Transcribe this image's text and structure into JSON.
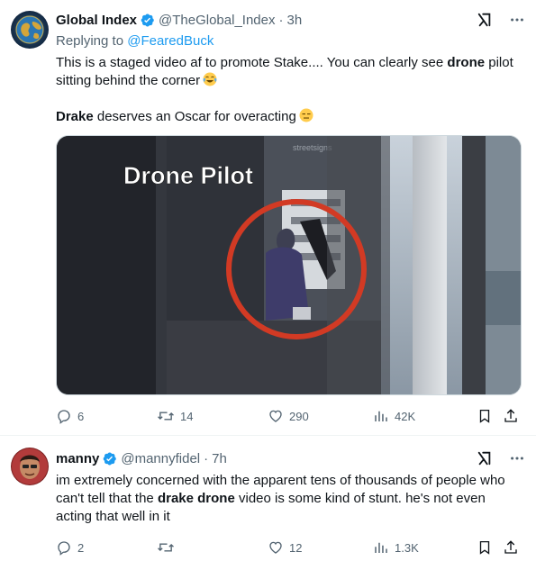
{
  "tweets": [
    {
      "author": "Global Index",
      "handle": "@TheGlobal_Index",
      "separator": "·",
      "time": "3h",
      "reply_prefix": "Replying to",
      "reply_handle": "@FearedBuck",
      "text": {
        "p1_a": "This is a staged video af to promote Stake.... You can clearly see ",
        "p1_bold": "drone",
        "p1_b": " pilot sitting behind the corner",
        "p2_bold": "Drake",
        "p2_a": " deserves an Oscar for overacting"
      },
      "media": {
        "overlay_text": "Drone Pilot",
        "sign_text": "streetsigns"
      },
      "stats": {
        "replies": "6",
        "reposts": "14",
        "likes": "290",
        "views": "42K"
      }
    },
    {
      "author": "manny",
      "handle": "@mannyfidel",
      "separator": "·",
      "time": "7h",
      "text": {
        "a": "im extremely concerned with the apparent tens of thousands of people who can't tell that the ",
        "bold": "drake drone",
        "b": " video is some kind of stunt. he's not even acting that well in it"
      },
      "stats": {
        "replies": "2",
        "reposts": "",
        "likes": "12",
        "views": "1.3K"
      }
    }
  ],
  "icons": {
    "verified": "verified-badge-icon",
    "grok": "grok-icon",
    "more": "more-icon",
    "reply": "reply-icon",
    "repost": "repost-icon",
    "like": "like-icon",
    "views": "views-icon",
    "bookmark": "bookmark-icon",
    "share": "share-icon",
    "emoji_laugh": "laughing-crying-emoji-icon",
    "emoji_expressionless": "expressionless-emoji-icon"
  },
  "colors": {
    "verified": "#1d9bf0",
    "link": "#1d9bf0",
    "secondary_text": "#536471",
    "circle": "#d23a24"
  }
}
